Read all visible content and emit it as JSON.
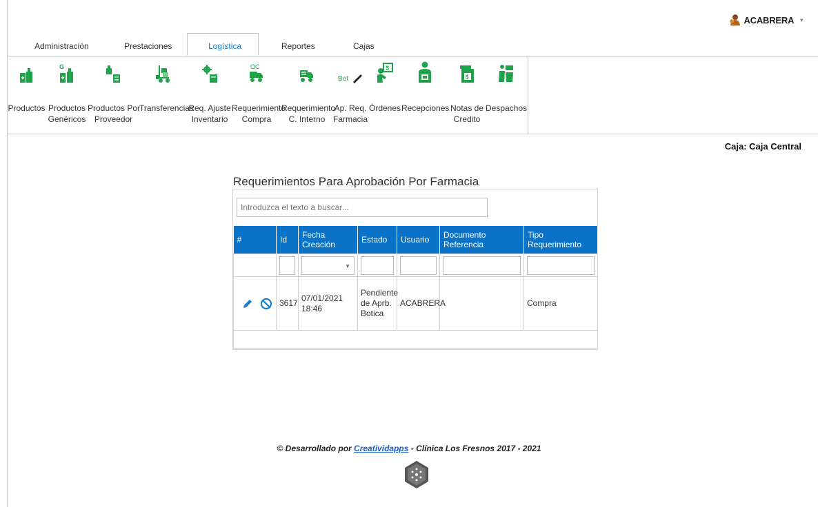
{
  "user": {
    "name": "ACABRERA"
  },
  "tabs": [
    {
      "label": "Administración"
    },
    {
      "label": "Prestaciones"
    },
    {
      "label": "Logística"
    },
    {
      "label": "Reportes"
    },
    {
      "label": "Cajas"
    }
  ],
  "ribbon": [
    {
      "line1": "Productos",
      "line2": "",
      "icon": "bottle-plus-icon"
    },
    {
      "line1": "Productos",
      "line2": "Genéricos",
      "icon": "generic-bottle-icon"
    },
    {
      "line1": "Productos Por",
      "line2": "Proveedor",
      "icon": "supplier-products-icon"
    },
    {
      "line1": "Transferencias",
      "line2": "",
      "icon": "transfer-cart-icon"
    },
    {
      "line1": "Req. Ajuste",
      "line2": "Inventario",
      "icon": "inventory-adjust-icon"
    },
    {
      "line1": "Requerimiento",
      "line2": "Compra",
      "icon": "purchase-truck-icon",
      "badge": "OC"
    },
    {
      "line1": "Requerimiento",
      "line2": "C. Interno",
      "icon": "internal-truck-icon"
    },
    {
      "line1": "Ap. Req.",
      "line2": "Farmacia",
      "icon": "pharmacy-approval-icon",
      "badge": "Bot"
    },
    {
      "line1": "Órdenes",
      "line2": "",
      "icon": "orders-icon"
    },
    {
      "line1": "Recepciones",
      "line2": "",
      "icon": "reception-icon"
    },
    {
      "line1": "Notas de",
      "line2": "Credito",
      "icon": "credit-note-icon"
    },
    {
      "line1": "Despachos",
      "line2": "",
      "icon": "dispatch-icon"
    }
  ],
  "caja": "Caja: Caja Central",
  "panel": {
    "title": "Requerimientos Para Aprobación Por Farmacia",
    "search_placeholder": "Introduzca el texto a buscar..."
  },
  "table": {
    "columns": [
      "#",
      "Id",
      "Fecha Creación",
      "Estado",
      "Usuario",
      "Documento Referencia",
      "Tipo Requerimiento"
    ],
    "rows": [
      {
        "id": "3617",
        "fecha": "07/01/2021 18:46",
        "estado": "Pendiente de Aprb. Botica",
        "usuario": "ACABRERA",
        "documento": "",
        "tipo": "Compra"
      }
    ]
  },
  "footer": {
    "prefix": "© Desarrollado por",
    "link": "Creatividapps",
    "suffix": "- Clínica Los Fresnos 2017 - 2021"
  },
  "colors": {
    "ribbon_green": "#1fa24a",
    "header_blue": "#0a73c8",
    "accent_blue": "#1a7fcf"
  }
}
